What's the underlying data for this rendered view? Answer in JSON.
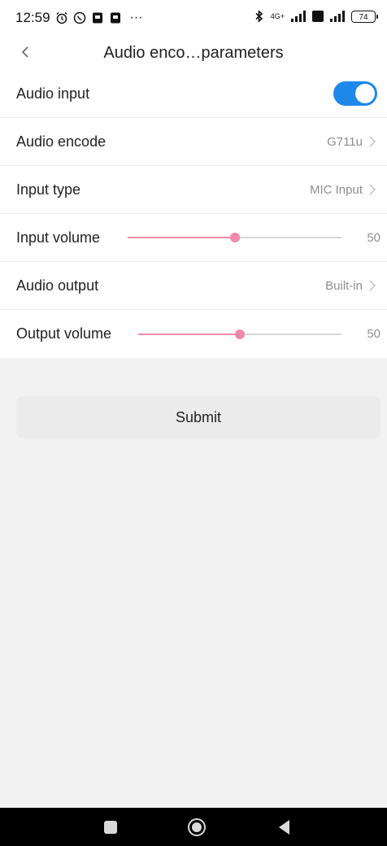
{
  "status_bar": {
    "time": "12:59",
    "more": "···",
    "network": "4G+",
    "battery": "74"
  },
  "header": {
    "title": "Audio enco…parameters"
  },
  "settings": {
    "audio_input": {
      "label": "Audio input",
      "enabled": true
    },
    "audio_encode": {
      "label": "Audio encode",
      "value": "G711u"
    },
    "input_type": {
      "label": "Input type",
      "value": "MIC Input"
    },
    "input_volume": {
      "label": "Input volume",
      "value": "50",
      "level": 0.5
    },
    "audio_output": {
      "label": "Audio output",
      "value": "Built-in"
    },
    "output_volume": {
      "label": "Output volume",
      "value": "50",
      "level": 0.5
    }
  },
  "submit_label": "Submit",
  "colors": {
    "toggle_on": "#1e88ea",
    "slider_accent": "#ef8aa8"
  }
}
